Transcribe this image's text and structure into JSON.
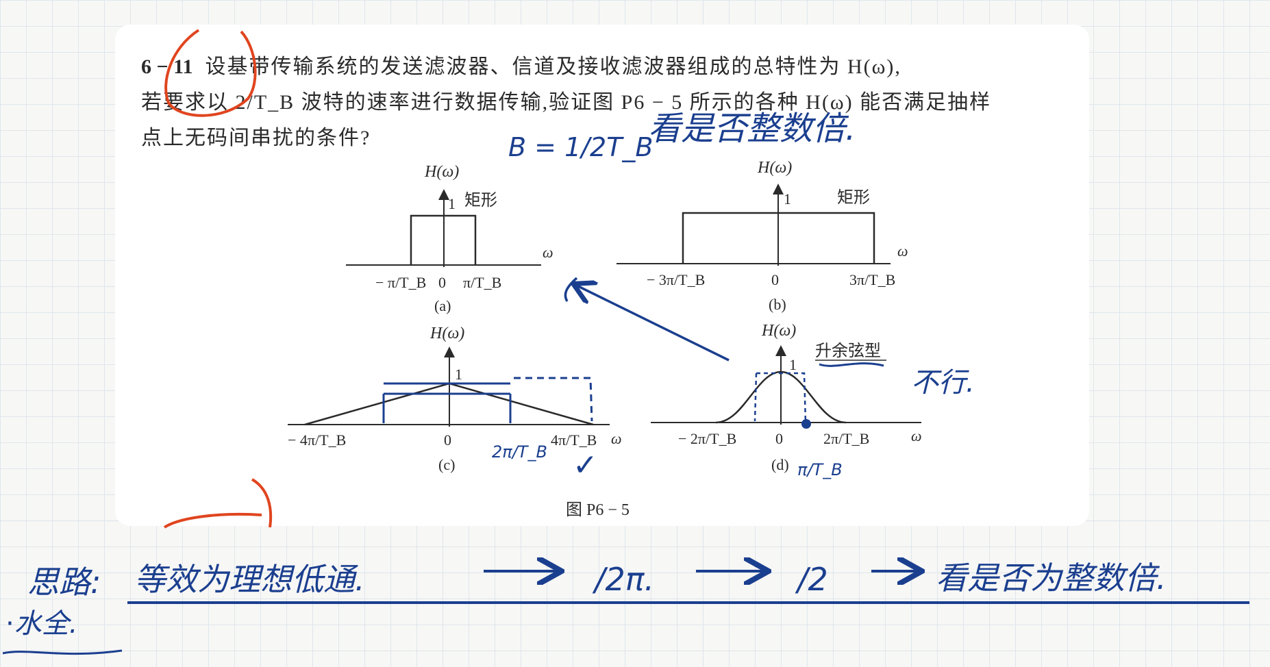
{
  "question": {
    "number": "6 − 11",
    "line1": "设基带传输系统的发送滤波器、信道及接收滤波器组成的总特性为 H(ω),",
    "line2": "若要求以 2/T_B 波特的速率进行数据传输,验证图 P6 − 5 所示的各种 H(ω) 能否满足抽样",
    "line3": "点上无码间串扰的条件?"
  },
  "figure_caption": "图 P6 − 5",
  "panels": {
    "a": {
      "ylabel": "H(ω)",
      "one": "1",
      "shape": "矩形",
      "xaxis": "ω",
      "tick_neg": "− π/T_B",
      "tick_zero": "0",
      "tick_pos": "π/T_B",
      "caption": "(a)"
    },
    "b": {
      "ylabel": "H(ω)",
      "one": "1",
      "shape": "矩形",
      "xaxis": "ω",
      "tick_neg": "− 3π/T_B",
      "tick_zero": "0",
      "tick_pos": "3π/T_B",
      "caption": "(b)"
    },
    "c": {
      "ylabel": "H(ω)",
      "one": "1",
      "xaxis": "ω",
      "tick_neg": "− 4π/T_B",
      "tick_zero": "0",
      "tick_pos": "4π/T_B",
      "caption": "(c)"
    },
    "d": {
      "ylabel": "H(ω)",
      "one": "1",
      "shape": "升余弦型",
      "xaxis": "ω",
      "tick_neg": "− 2π/T_B",
      "tick_zero": "0",
      "tick_pos": "2π/T_B",
      "caption": "(d)"
    }
  },
  "handwritten": {
    "b_formula": "B = 1/2T_B",
    "top_note": "看是否整数倍.",
    "c_mark": "2π/T_B",
    "c_check": "✓",
    "d_mark": "π/T_B",
    "d_note": "不行.",
    "idea_label": "思路:",
    "idea_step1": "等效为理想低通.",
    "idea_step2": "/2π.",
    "idea_step3": "/2",
    "idea_step4": "看是否为整数倍.",
    "idea_line2": "⋅水全."
  },
  "colors": {
    "ink_blue": "#1b3f8f",
    "ink_red": "#e0451f",
    "text": "#2a2a2a"
  }
}
